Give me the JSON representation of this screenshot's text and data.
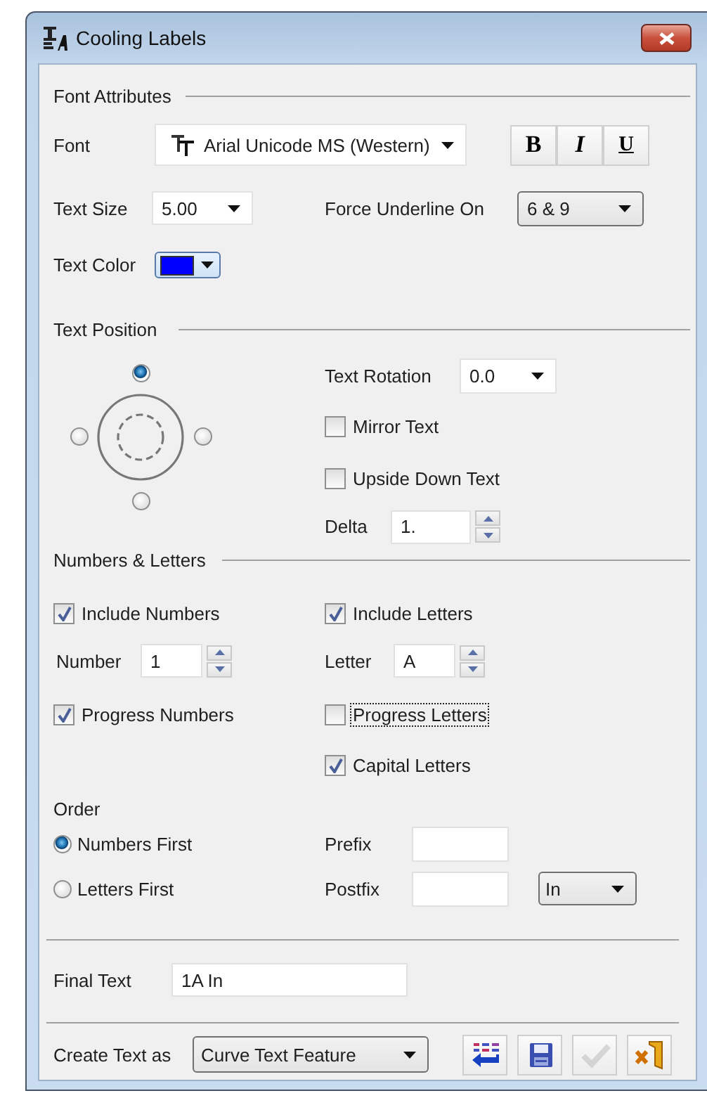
{
  "window": {
    "title": "Cooling Labels"
  },
  "font_attributes": {
    "heading": "Font Attributes",
    "font": {
      "label": "Font",
      "value": "Arial Unicode MS (Western)"
    },
    "style_buttons": [
      {
        "kind": "bold",
        "label": "B"
      },
      {
        "kind": "italic",
        "label": "I"
      },
      {
        "kind": "underline",
        "label": "U"
      }
    ],
    "text_size": {
      "label": "Text Size",
      "value": "5.00"
    },
    "force_underline": {
      "label": "Force Underline On",
      "value": "6 & 9"
    },
    "text_color": {
      "label": "Text Color",
      "color": "#0000ff"
    }
  },
  "text_position": {
    "heading": "Text Position",
    "anchors": [
      {
        "kind": "top",
        "selected": true
      },
      {
        "kind": "left",
        "selected": false
      },
      {
        "kind": "right",
        "selected": false
      },
      {
        "kind": "bottom",
        "selected": false
      }
    ],
    "rotation": {
      "label": "Text Rotation",
      "value": "0.0"
    },
    "mirror_text": {
      "label": "Mirror Text",
      "checked": false,
      "focused": false
    },
    "upside_down_text": {
      "label": "Upside Down Text",
      "checked": false,
      "focused": false
    },
    "delta": {
      "label": "Delta",
      "value": "1."
    }
  },
  "numbers_letters": {
    "heading": "Numbers & Letters",
    "include_numbers": {
      "label": "Include Numbers",
      "checked": true,
      "focused": false
    },
    "include_letters": {
      "label": "Include Letters",
      "checked": true,
      "focused": false
    },
    "number": {
      "label": "Number",
      "value": "1"
    },
    "letter": {
      "label": "Letter",
      "value": "A"
    },
    "progress_numbers": {
      "label": "Progress Numbers",
      "checked": true,
      "focused": false
    },
    "progress_letters": {
      "label": "Progress Letters",
      "checked": false,
      "focused": true
    },
    "capital_letters": {
      "label": "Capital Letters",
      "checked": true,
      "focused": false
    }
  },
  "order": {
    "heading": "Order",
    "options": [
      {
        "label": "Numbers First",
        "selected": true
      },
      {
        "label": "Letters First",
        "selected": false
      }
    ],
    "prefix": {
      "label": "Prefix"
    },
    "postfix": {
      "label": "Postfix"
    },
    "unit": {
      "value": "In"
    }
  },
  "final_text": {
    "label": "Final Text",
    "value": "1A In"
  },
  "create_text_as": {
    "label": "Create Text as",
    "value": "Curve Text Feature"
  },
  "toolbar": [
    {
      "kind": "list-swap",
      "disabled": false
    },
    {
      "kind": "save",
      "disabled": false
    },
    {
      "kind": "apply",
      "disabled": true
    },
    {
      "kind": "exit",
      "disabled": false
    }
  ]
}
